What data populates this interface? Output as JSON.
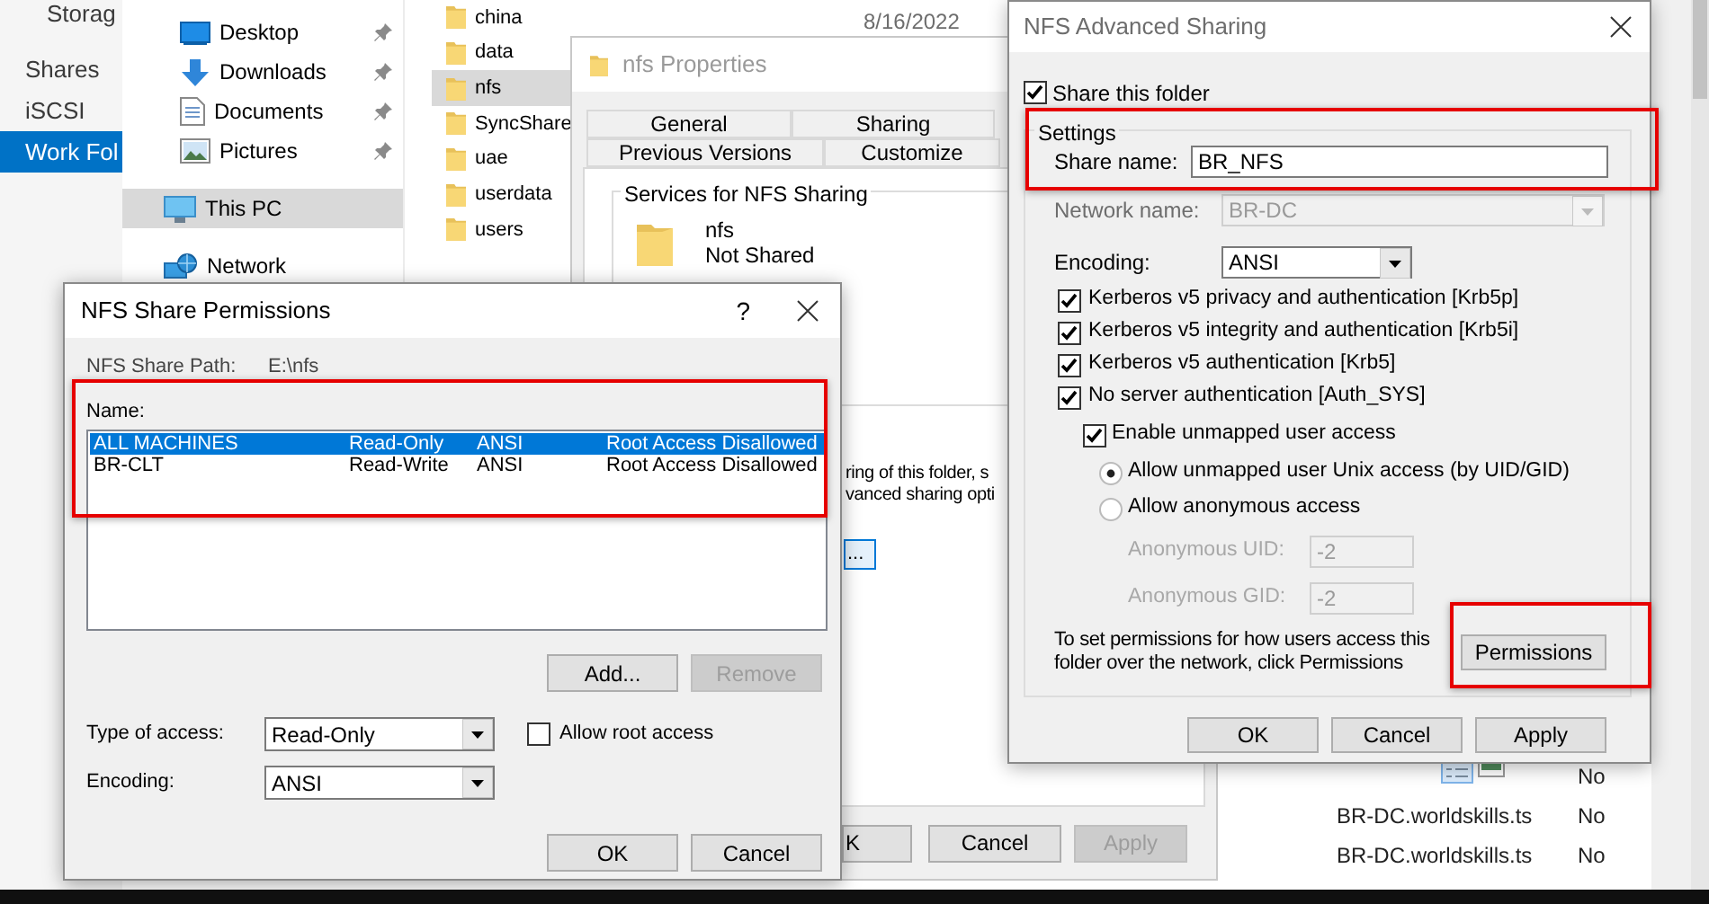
{
  "server_manager": {
    "nav": [
      {
        "label": "Storag",
        "kind": "sub",
        "selected": false
      },
      {
        "label": "Shares",
        "kind": "top",
        "selected": false
      },
      {
        "label": "iSCSI",
        "kind": "top",
        "selected": false
      },
      {
        "label": "Work Fol",
        "kind": "top",
        "selected": true
      }
    ]
  },
  "explorer": {
    "nav": [
      {
        "label": "Desktop",
        "kind": "desktop",
        "pinned": true,
        "selected": false
      },
      {
        "label": "Downloads",
        "kind": "downloads",
        "pinned": true,
        "selected": false
      },
      {
        "label": "Documents",
        "kind": "documents",
        "pinned": true,
        "selected": false
      },
      {
        "label": "Pictures",
        "kind": "pictures",
        "pinned": true,
        "selected": false
      },
      {
        "label": "This PC",
        "kind": "pc",
        "pinned": false,
        "selected": true
      },
      {
        "label": "Network",
        "kind": "network",
        "pinned": false,
        "selected": false
      }
    ],
    "files": [
      {
        "name": "china",
        "selected": false
      },
      {
        "name": "data",
        "selected": false
      },
      {
        "name": "nfs",
        "selected": true
      },
      {
        "name": "SyncShare",
        "selected": false
      },
      {
        "name": "uae",
        "selected": false
      },
      {
        "name": "userdata",
        "selected": false
      },
      {
        "name": "users",
        "selected": false
      }
    ],
    "date": "8/16/2022"
  },
  "properties": {
    "title": "nfs Properties",
    "tab_rows": [
      [
        {
          "label": "General",
          "selected": false
        },
        {
          "label": "Sharing",
          "selected": false
        }
      ],
      [
        {
          "label": "Previous Versions",
          "selected": false
        },
        {
          "label": "Customize",
          "selected": false
        }
      ]
    ],
    "group_label": "Services for NFS Sharing",
    "folder_name": "nfs",
    "folder_status": "Not Shared",
    "text_lines": [
      "ring of this folder, s",
      "vanced sharing opti"
    ],
    "advanced_button": "...",
    "buttons": [
      {
        "label": "K",
        "disabled": false
      },
      {
        "label": "Cancel",
        "disabled": false
      },
      {
        "label": "Apply",
        "disabled": true
      }
    ]
  },
  "background_list": {
    "rows": [
      {
        "shared": "No"
      },
      {
        "host": "BR-DC.worldskills.ts",
        "shared": "No"
      },
      {
        "host": "BR-DC.worldskills.ts",
        "shared": "No"
      }
    ]
  },
  "permissions_dialog": {
    "title": "NFS Share Permissions",
    "help": "?",
    "path_label": "NFS Share Path:",
    "path": "E:\\nfs",
    "name_label": "Name:",
    "entries": [
      {
        "name": "ALL MACHINES",
        "access": "Read-Only",
        "encoding": "ANSI",
        "root": "Root Access Disallowed",
        "selected": true
      },
      {
        "name": "BR-CLT",
        "access": "Read-Write",
        "encoding": "ANSI",
        "root": "Root Access Disallowed",
        "selected": false
      }
    ],
    "list_buttons": [
      {
        "label": "Add...",
        "disabled": false
      },
      {
        "label": "Remove",
        "disabled": true
      }
    ],
    "access_label": "Type of access:",
    "access_value": "Read-Only",
    "allow_root": {
      "label": "Allow root access",
      "checked": false
    },
    "encoding_label": "Encoding:",
    "encoding_value": "ANSI",
    "buttons": [
      {
        "label": "OK",
        "disabled": false
      },
      {
        "label": "Cancel",
        "disabled": false
      }
    ]
  },
  "advanced_dialog": {
    "title": "NFS Advanced Sharing",
    "share_folder": {
      "label": "Share this folder",
      "checked": true
    },
    "group_label": "Settings",
    "share_name_label": "Share name:",
    "share_name": "BR_NFS",
    "network_label": "Network name:",
    "network_value": "BR-DC",
    "network_disabled": true,
    "encoding_label": "Encoding:",
    "encoding_value": "ANSI",
    "auth": [
      {
        "label": "Kerberos v5 privacy and authentication [Krb5p]",
        "checked": true
      },
      {
        "label": "Kerberos v5 integrity and authentication [Krb5i]",
        "checked": true
      },
      {
        "label": "Kerberos v5 authentication [Krb5]",
        "checked": true
      },
      {
        "label": "No server authentication [Auth_SYS]",
        "checked": true
      }
    ],
    "unmapped": {
      "label": "Enable unmapped user access",
      "checked": true
    },
    "access_modes": [
      {
        "label": "Allow unmapped user Unix access (by UID/GID)",
        "selected": true
      },
      {
        "label": "Allow anonymous access",
        "selected": false
      }
    ],
    "anonymous": [
      {
        "label": "Anonymous UID:",
        "value": "-2",
        "disabled": true
      },
      {
        "label": "Anonymous GID:",
        "value": "-2",
        "disabled": true
      }
    ],
    "hint": "To set permissions for how users access this folder over the network, click Permissions",
    "permissions_button": "Permissions",
    "buttons": [
      {
        "label": "OK",
        "disabled": false
      },
      {
        "label": "Cancel",
        "disabled": false
      },
      {
        "label": "Apply",
        "disabled": false
      }
    ]
  }
}
